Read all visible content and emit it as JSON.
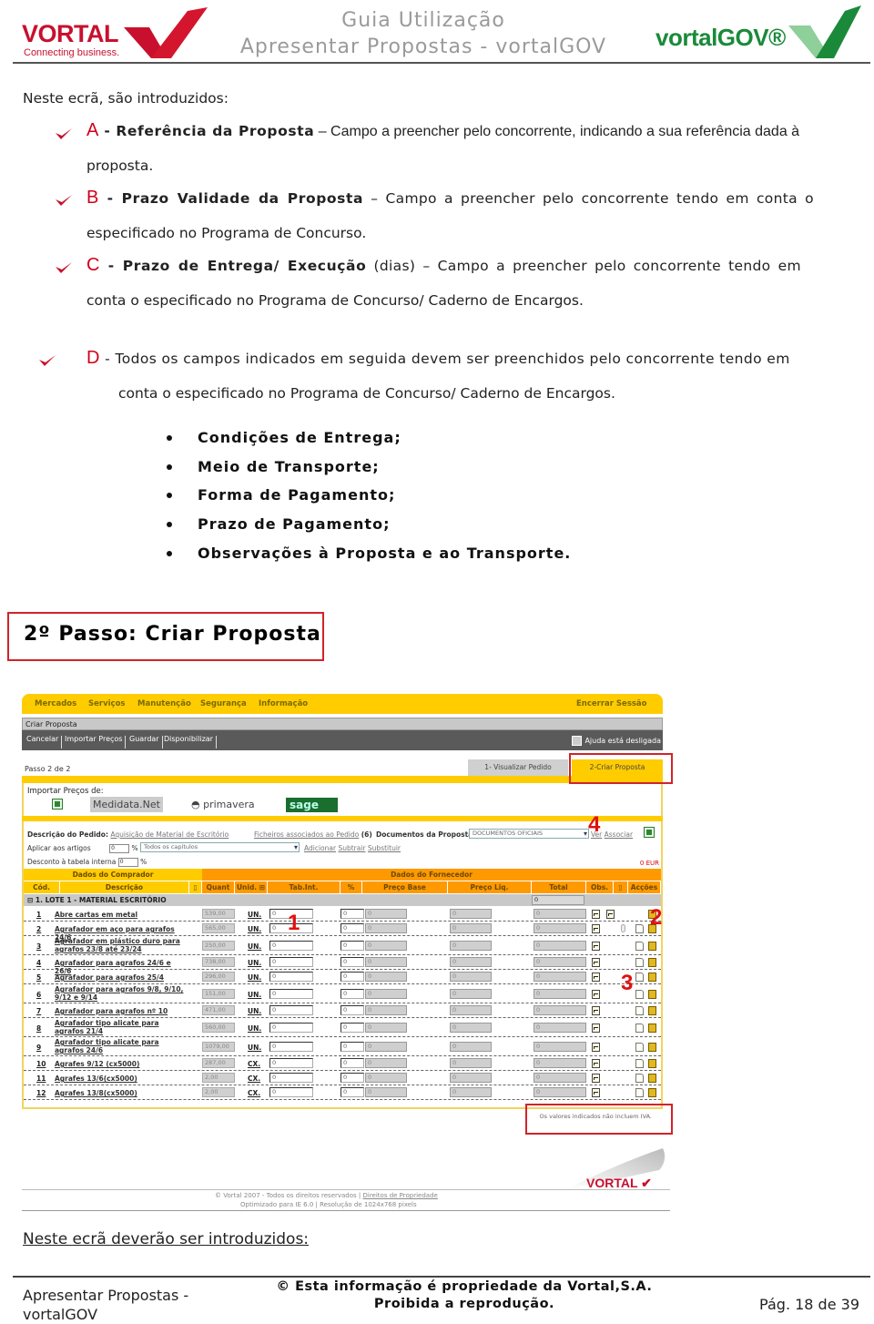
{
  "header": {
    "title_line1": "Guia Utilização",
    "title_line2": "Apresentar Propostas - vortalGOV",
    "logo_left_word": "VORTAL",
    "logo_left_tagline": "Connecting business.",
    "logo_right_word": "vortalGOV®"
  },
  "intro": "Neste ecrã, são introduzidos:",
  "items": [
    {
      "letter": "A",
      "label": " - Referência da Proposta",
      "text1": " – Campo a preencher pelo concorrente, indicando a sua referência dada à",
      "text2": "proposta."
    },
    {
      "letter": "B",
      "label": " - Prazo Validade da Proposta",
      "text1": " – Campo a preencher pelo concorrente tendo em conta o",
      "text2": "especificado no Programa de Concurso."
    },
    {
      "letter": "C",
      "label": " - Prazo de Entrega/ Execução",
      "text1": " (dias) – Campo a preencher pelo concorrente tendo em",
      "text2": "conta o especificado no Programa de Concurso/ Caderno de Encargos."
    },
    {
      "letter": "D",
      "label": "",
      "text1": " - Todos os campos indicados em seguida devem ser preenchidos pelo concorrente tendo em",
      "text2": "conta o especificado no Programa de Concurso/ Caderno de Encargos."
    }
  ],
  "sublist": [
    "Condições de Entrega;",
    "Meio de Transporte;",
    "Forma de Pagamento;",
    "Prazo de Pagamento;",
    "Observações à Proposta e ao Transporte."
  ],
  "step_title": "2º Passo: Criar Proposta",
  "app": {
    "nav": [
      "Mercados",
      "Serviços",
      "Manutenção",
      "Segurança",
      "Informação"
    ],
    "logout": "Encerrar Sessão",
    "page_title": "Criar Proposta",
    "toolbar": [
      "Cancelar",
      "Importar Preços",
      "Guardar",
      "Disponibilizar"
    ],
    "help": "Ajuda está desligada",
    "step": "Passo 2 de 2",
    "tabs": [
      "1- Visualizar Pedido",
      "2-Criar Proposta"
    ],
    "import_title": "Importar Preços de:",
    "import_sources": [
      "Medidata.Net",
      "primavera",
      "sage"
    ],
    "desc_label": "Descrição do Pedido:",
    "desc_value": "Aquisição de Material de Escritório",
    "files_link": "Ficheiros associados ao Pedido",
    "files_count": "(6)",
    "docs_label": "Documentos da Proposta:",
    "docs_value": "DOCUMENTOS OFICIAIS",
    "ver": "Ver",
    "associar": "Associar",
    "apply_label": "Aplicar aos artigos",
    "apply_value": "0",
    "percent": "%",
    "chapters": "Todos os capítulos",
    "adicionar": "Adicionar",
    "subtrair": "Subtrair",
    "substituir": "Substituir",
    "discount_label": "Desconto à tabela interna",
    "discount_value": "0",
    "total_eur": "0 EUR",
    "group_buyer": "Dados do Comprador",
    "group_supplier": "Dados do Fornecedor",
    "columns": [
      "Cód.",
      "Descrição",
      "Quant",
      "Unid.",
      "Tab.Int.",
      "%",
      "Preço Base",
      "Preço Liq.",
      "Total",
      "Obs.",
      "Acções"
    ],
    "lote": "1.  LOTE 1 - MATERIAL ESCRITÓRIO",
    "lote_total": "0",
    "rows": [
      {
        "cod": "1",
        "desc": "Abre cartas em metal",
        "quant": "539,00",
        "unid": "UN.",
        "tab": "0",
        "pct": "0",
        "base": "0",
        "liq": "0",
        "total": "0"
      },
      {
        "cod": "2",
        "desc": "Agrafador em aço para agrafos 24/6",
        "quant": "565,00",
        "unid": "UN.",
        "tab": "0",
        "pct": "0",
        "base": "0",
        "liq": "0",
        "total": "0"
      },
      {
        "cod": "3",
        "desc": "Agrafador em plástico duro para agrafos 23/8 até 23/24",
        "quant": "250,00",
        "unid": "UN.",
        "tab": "0",
        "pct": "0",
        "base": "0",
        "liq": "0",
        "total": "0"
      },
      {
        "cod": "4",
        "desc": "Agrafador para agrafos 24/6 e 26/6",
        "quant": "738,00",
        "unid": "UN.",
        "tab": "0",
        "pct": "0",
        "base": "0",
        "liq": "0",
        "total": "0"
      },
      {
        "cod": "5",
        "desc": "Agrafador para agrafos 25/4",
        "quant": "296,00",
        "unid": "UN.",
        "tab": "0",
        "pct": "0",
        "base": "0",
        "liq": "0",
        "total": "0"
      },
      {
        "cod": "6",
        "desc": "Agrafador para agrafos 9/8, 9/10, 9/12 e 9/14",
        "quant": "151,00",
        "unid": "UN.",
        "tab": "0",
        "pct": "0",
        "base": "0",
        "liq": "0",
        "total": "0"
      },
      {
        "cod": "7",
        "desc": "Agrafador para agrafos nº 10",
        "quant": "471,00",
        "unid": "UN.",
        "tab": "0",
        "pct": "0",
        "base": "0",
        "liq": "0",
        "total": "0"
      },
      {
        "cod": "8",
        "desc": "Agrafador tipo alicate para agrafos 21/4",
        "quant": "560,00",
        "unid": "UN.",
        "tab": "0",
        "pct": "0",
        "base": "0",
        "liq": "0",
        "total": "0"
      },
      {
        "cod": "9",
        "desc": "Agrafador tipo alicate para agrafos 24/6",
        "quant": "1079,00",
        "unid": "UN.",
        "tab": "0",
        "pct": "0",
        "base": "0",
        "liq": "0",
        "total": "0"
      },
      {
        "cod": "10",
        "desc": "Agrafes 9/12 (cx5000)",
        "quant": "287,00",
        "unid": "CX.",
        "tab": "0",
        "pct": "0",
        "base": "0",
        "liq": "0",
        "total": "0"
      },
      {
        "cod": "11",
        "desc": "Agrafes 13/6(cx5000)",
        "quant": "2,00",
        "unid": "CX.",
        "tab": "0",
        "pct": "0",
        "base": "0",
        "liq": "0",
        "total": "0"
      },
      {
        "cod": "12",
        "desc": "Agrafes 13/8(cx5000)",
        "quant": "2,00",
        "unid": "CX.",
        "tab": "0",
        "pct": "0",
        "base": "0",
        "liq": "0",
        "total": "0"
      }
    ],
    "iva_note": "Os valores indicados não incluem IVA.",
    "annotations": [
      "1",
      "2",
      "3",
      "4"
    ],
    "footer_logo": "VORTAL",
    "footer_line1": "© Vortal 2007 - Todos os direitos reservados | ",
    "footer_link": "Direitos de Propriedade",
    "footer_line2": "Optimizado para IE 6.0 | Resolução de 1024x768 pixels"
  },
  "intro2": "Neste ecrã deverão ser introduzidos:",
  "page_footer": {
    "left_line1": "Apresentar Propostas -",
    "left_line2": "vortalGOV",
    "center_line1": "© Esta informação é propriedade da Vortal,S.A.",
    "center_line2": "Proibida a reprodução.",
    "page": "Pág. 18 de 39"
  }
}
